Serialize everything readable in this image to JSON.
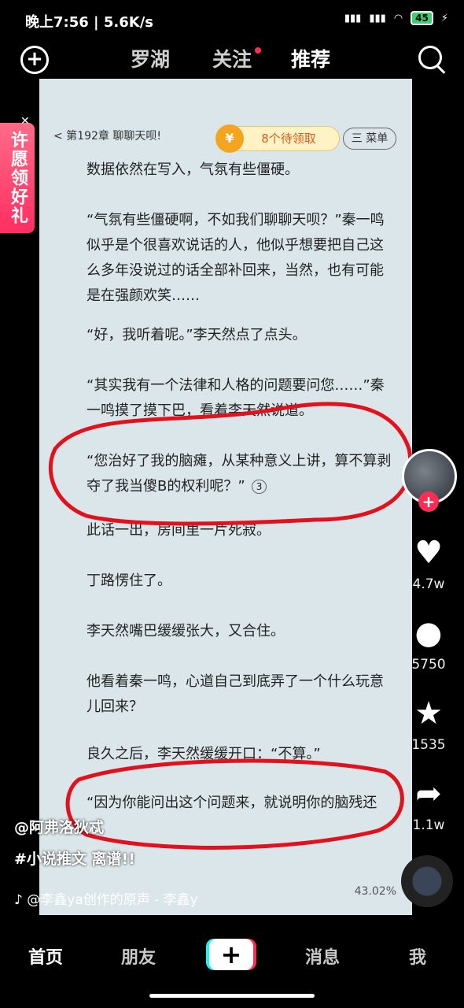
{
  "status": {
    "time": "晚上7:56 | 5.6K/s",
    "battery": "45"
  },
  "top_nav": {
    "tabs": [
      "罗湖",
      "关注",
      "推荐"
    ]
  },
  "book": {
    "chapter": "< 第192章 聊聊天呗!",
    "pending_reward": "8个待领取",
    "menu": "三 菜单",
    "coin": "¥",
    "paragraphs": [
      "数据依然在写入，气氛有些僵硬。",
      "“气氛有些僵硬啊，不如我们聊聊天呗？”秦一鸣似乎是个很喜欢说话的人，他似乎想要把自己这么多年没说过的话全部补回来，当然，也有可能是在强颜欢笑……",
      "“好，我听着呢。”李天然点了点头。",
      "“其实我有一个法律和人格的问题要问您……”秦一鸣摸了摸下巴，看着李天然说道。",
      "“您治好了我的脑瘫，从某种意义上讲，算不算剥夺了我当傻B的权利呢？”",
      "此话一出，房间里一片死寂。",
      "丁路愣住了。",
      "李天然嘴巴缓缓张大，又合住。",
      "他看着秦一鸣，心道自己到底弄了一个什么玩意儿回来？",
      "良久之后，李天然缓缓开口：“不算。”",
      "“因为你能问出这个问题来，就说明你的脑残还"
    ],
    "comment_count": "3",
    "progress": "43.02%"
  },
  "wish_banner": "许愿领好礼",
  "rail": {
    "likes": "4.7w",
    "comments": "5750",
    "favorites": "1535",
    "shares": "1.1w"
  },
  "caption": {
    "author": "@阿弗洛狄忒",
    "tags": "#小说推文 离谱!!",
    "music": "♪ @李鑫ya创作的原声 - 李鑫y"
  },
  "bottom_nav": {
    "tabs": [
      "首页",
      "朋友",
      "消息",
      "我"
    ],
    "plus": "+"
  }
}
